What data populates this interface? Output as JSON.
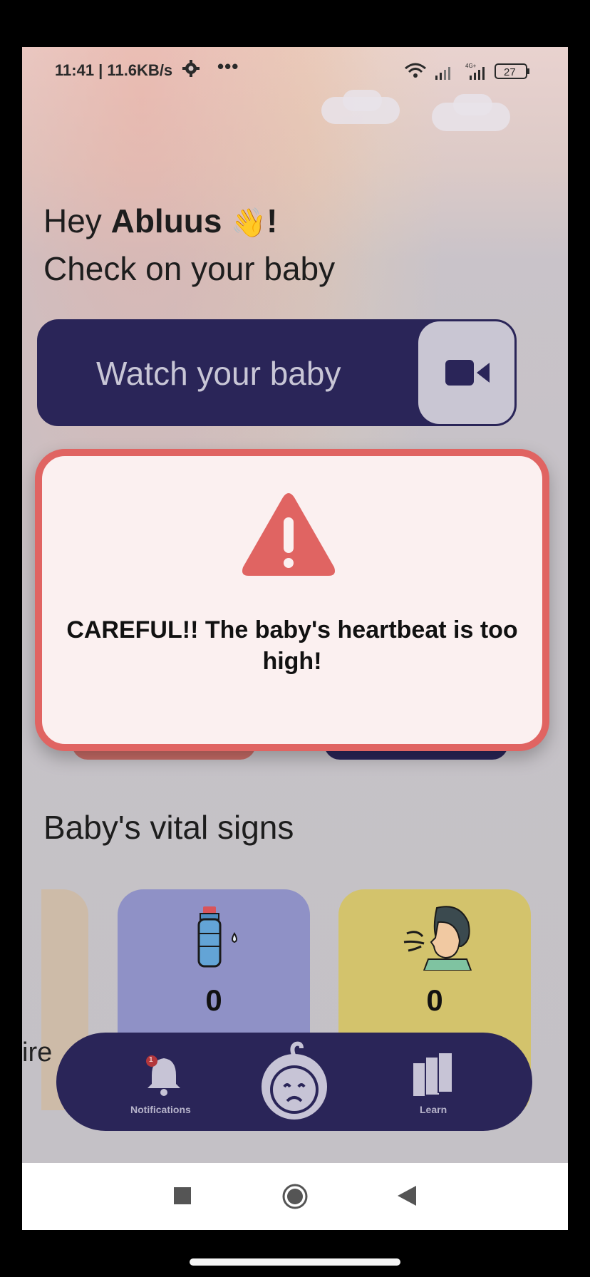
{
  "status_bar": {
    "time": "11:41 | 11.6KB/s",
    "overflow": "•••",
    "network_label": "4G+",
    "battery": "27"
  },
  "greeting": {
    "hey": "Hey",
    "name": "Abluus",
    "wave_emoji": "👋",
    "exclaim": "!",
    "subtitle": "Check on your baby"
  },
  "watch_button": {
    "label": "Watch your baby",
    "icon": "video-camera-icon"
  },
  "alert": {
    "icon": "warning-triangle-icon",
    "message": "CAREFUL!! The baby's heartbeat is too high!",
    "color": "#e06462"
  },
  "vitals": {
    "title": "Baby's vital signs",
    "partial_label": "ire",
    "cards": [
      {
        "icon": "water-bottle-icon",
        "value": "0",
        "color": "#8f91c6"
      },
      {
        "icon": "breathing-face-icon",
        "value": "0",
        "color": "#d3c36c"
      }
    ]
  },
  "bottom_nav": {
    "notifications_label": "Notifications",
    "notifications_badge": "1",
    "center_icon": "baby-face-icon",
    "learn_label": "Learn"
  },
  "system_nav": {
    "recents": "recents-square-icon",
    "home": "home-circle-icon",
    "back": "back-triangle-icon"
  },
  "colors": {
    "primary": "#2a2558",
    "alert": "#e06462"
  }
}
